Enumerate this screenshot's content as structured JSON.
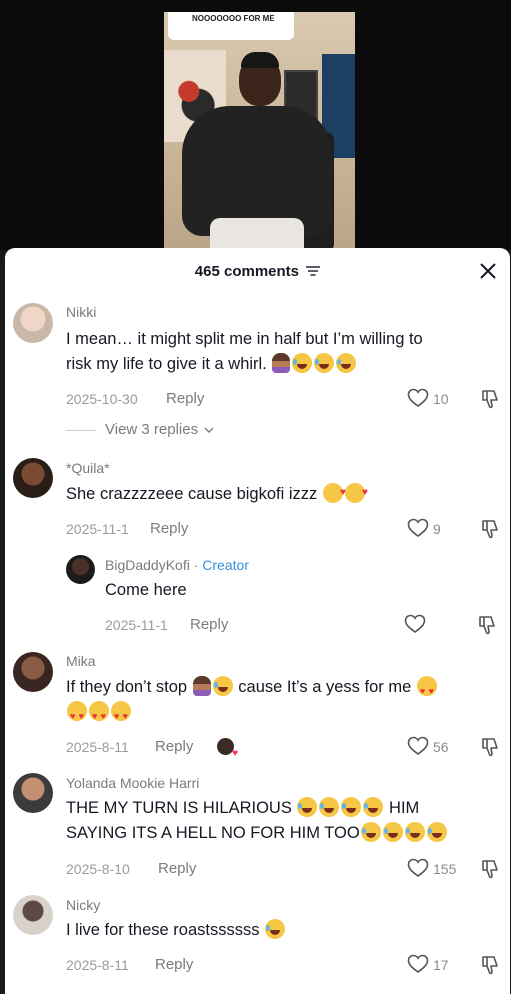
{
  "video": {
    "caption": "NOOOOOOO FOR ME"
  },
  "sheet": {
    "title": "465 comments",
    "icons": {
      "filter": "filter-icon",
      "close": "close-icon",
      "like": "heart-outline-icon",
      "dislike": "thumbs-down-icon"
    }
  },
  "comments": [
    {
      "username": "Nikki",
      "text_line1": "I mean… it might split me in half but I’m willing to",
      "text_line2": "risk my life to give it a whirl.",
      "date": "2025-10-30",
      "reply_label": "Reply",
      "likes": "10",
      "view_replies": "View 3 replies"
    },
    {
      "username": "*Quila*",
      "text": "She crazzzzeee cause bigkofi izzz",
      "date": "2025-11-1",
      "reply_label": "Reply",
      "likes": "9",
      "reply": {
        "username": "BigDaddyKofi",
        "separator": "·",
        "badge": "Creator",
        "text": "Come here",
        "date": "2025-11-1",
        "reply_label": "Reply"
      }
    },
    {
      "username": "Mika",
      "text_part1": "If they don’t stop",
      "text_part2": "cause It’s a yess for me",
      "date": "2025-8-11",
      "reply_label": "Reply",
      "likes": "56"
    },
    {
      "username": "Yolanda Mookie Harri",
      "text_part1": "THE MY TURN IS HILARIOUS",
      "text_part2": "HIM",
      "text_line2": "SAYING ITS A HELL NO FOR HIM TOO",
      "date": "2025-8-10",
      "reply_label": "Reply",
      "likes": "155"
    },
    {
      "username": "Nicky",
      "text": "I live for these roastssssss",
      "date": "2025-8-11",
      "reply_label": "Reply",
      "likes": "17"
    }
  ],
  "colors": {
    "text": "#161823",
    "muted": "#7a7b80",
    "creator": "#3a8fd9",
    "emoji_yellow": "#f6c744",
    "heart_red": "#e8303f"
  }
}
